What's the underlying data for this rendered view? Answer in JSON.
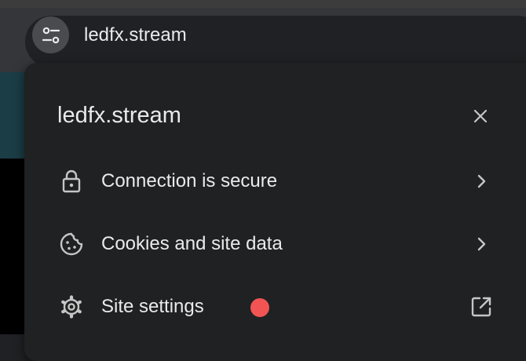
{
  "omnibox": {
    "url": "ledfx.stream",
    "chip_icon": "tune-icon"
  },
  "site_info_popup": {
    "title": "ledfx.stream",
    "close_icon": "close-icon",
    "rows": [
      {
        "label": "Connection is secure",
        "icon": "lock-icon",
        "trailing": "chevron-right-icon"
      },
      {
        "label": "Cookies and site data",
        "icon": "cookie-icon",
        "trailing": "chevron-right-icon"
      },
      {
        "label": "Site settings",
        "icon": "gear-icon",
        "trailing": "open-in-new-icon",
        "badge": "notification-dot"
      }
    ]
  },
  "colors": {
    "popup_bg": "#1f2122",
    "text": "#e8eaed",
    "icon": "#c4c7c5",
    "notification_dot": "#f25454"
  }
}
